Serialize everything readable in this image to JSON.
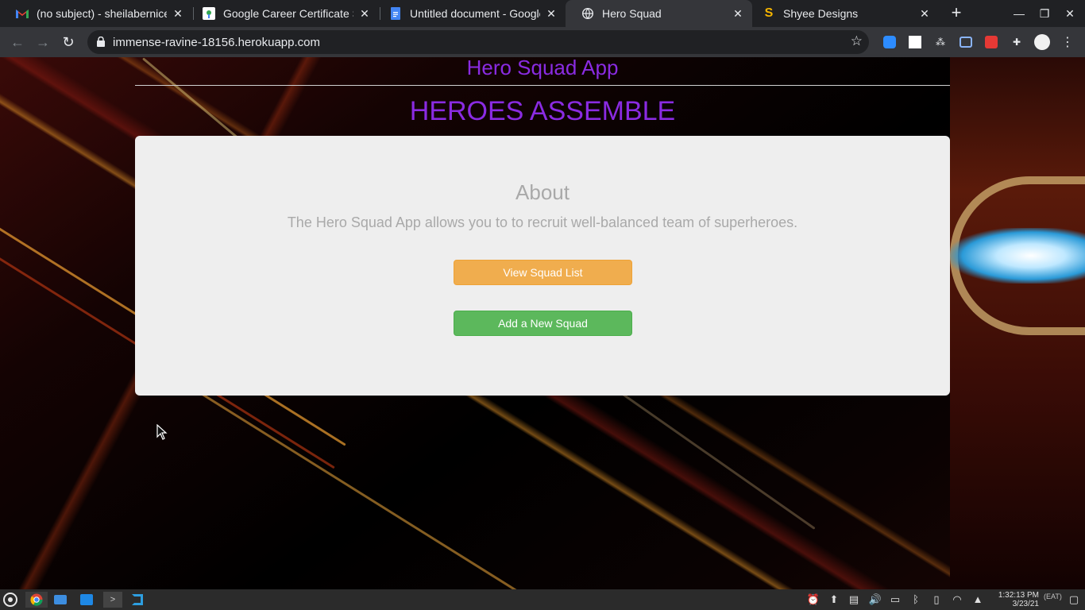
{
  "browser": {
    "tabs": [
      {
        "title": "(no subject) - sheilabernicew",
        "icon": "gmail-icon",
        "active": false
      },
      {
        "title": "Google Career Certificate Sch",
        "icon": "google-certificate-icon",
        "active": false
      },
      {
        "title": "Untitled document - Google",
        "icon": "google-docs-icon",
        "active": false
      },
      {
        "title": "Hero Squad",
        "icon": "globe-icon",
        "active": true
      },
      {
        "title": "Shyee Designs",
        "icon": "shyee-s-icon",
        "active": false
      }
    ],
    "new_tab": "+",
    "url": "immense-ravine-18156.herokuapp.com"
  },
  "page": {
    "app_title": "Hero Squad App",
    "hero_title": "HEROES ASSEMBLE",
    "about_heading": "About",
    "about_text": "The Hero Squad App allows you to to recruit well-balanced team of superheroes.",
    "view_button": "View Squad List",
    "add_button": "Add a New Squad"
  },
  "taskbar": {
    "time": "1:32:13 PM",
    "date": "3/23/21",
    "timezone": "(EAT)"
  },
  "colors": {
    "heading_purple": "#8a2be2",
    "warning": "#f0ad4e",
    "success": "#5cb85c",
    "jumbotron": "#eeeeee"
  }
}
